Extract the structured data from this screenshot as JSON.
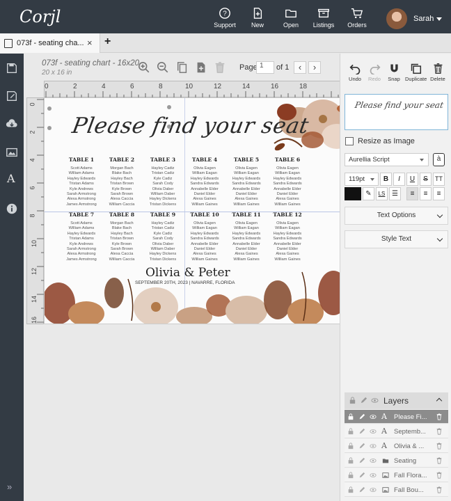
{
  "app": {
    "logo": "Corjl",
    "nav": [
      {
        "label": "Support",
        "icon": "help-icon"
      },
      {
        "label": "New",
        "icon": "new-file-icon"
      },
      {
        "label": "Open",
        "icon": "folder-icon"
      },
      {
        "label": "Listings",
        "icon": "listings-icon"
      },
      {
        "label": "Orders",
        "icon": "cart-icon"
      }
    ],
    "user": {
      "name": "Sarah"
    }
  },
  "tab": {
    "title": "073f - seating cha...",
    "close": "×",
    "add": "+"
  },
  "document": {
    "title": "073f - seating chart - 16x20",
    "size": "20 x 16 in",
    "page_label": "Page",
    "page_value": "1",
    "page_of": "of 1",
    "prev": "‹",
    "next": "›"
  },
  "ruler": {
    "h": [
      "0",
      "2",
      "4",
      "6",
      "8",
      "10",
      "12",
      "14",
      "16",
      "18"
    ],
    "v": [
      "0",
      "2",
      "4",
      "6",
      "8",
      "10",
      "12",
      "14",
      "16"
    ]
  },
  "canvas": {
    "caption": "Please find your seat",
    "couple": "Olivia & Peter",
    "date": "SEPTEMBER 20TH, 2023 | NAVARRE, FLORIDA",
    "tables": [
      {
        "title": "TABLE 1",
        "names": [
          "Scott Adams",
          "William Adams",
          "Hayley Edwards",
          "Tristan Adams",
          "Kyle Andrews",
          "Sarah Armstrong",
          "Alexa Armstrong",
          "James Armstrong"
        ]
      },
      {
        "title": "TABLE 2",
        "names": [
          "Morgan Bach",
          "Blake Bach",
          "Hayley Bach",
          "Tristan Brown",
          "Kyle Brown",
          "Sarah Brown",
          "Alexa Caccia",
          "William Caccia"
        ]
      },
      {
        "title": "TABLE 3",
        "names": [
          "Hayley Cadiz",
          "Tristan Cadiz",
          "Kyle Cadiz",
          "Sarah Cody",
          "Olivia Daber",
          "William Daber",
          "Hayley Dickens",
          "Tristan Dickens"
        ]
      },
      {
        "title": "TABLE 4",
        "names": [
          "Olivia Eagen",
          "William Eagan",
          "Hayley Edwards",
          "Sandra Edwards",
          "Annabelle Elder",
          "Daniel Elder",
          "Alexa Gaines",
          "William Gaines"
        ]
      },
      {
        "title": "TABLE 5",
        "names": [
          "Olivia Eagen",
          "William Eagan",
          "Hayley Edwards",
          "Sandra Edwards",
          "Annabelle Elder",
          "Daniel Elder",
          "Alexa Gaines",
          "William Gaines"
        ]
      },
      {
        "title": "TABLE 6",
        "names": [
          "Olivia Eagen",
          "William Eagan",
          "Hayley Edwards",
          "Sandra Edwards",
          "Annabelle Elder",
          "Daniel Elder",
          "Alexa Gaines",
          "William Gaines"
        ]
      },
      {
        "title": "TABLE 7",
        "names": [
          "Scott Adams",
          "William Adams",
          "Hayley Edwards",
          "Tristan Adams",
          "Kyle Andrews",
          "Sarah Armstrong",
          "Alexa Armstrong",
          "James Armstrong"
        ]
      },
      {
        "title": "TABLE 8",
        "names": [
          "Morgan Bach",
          "Blake Bach",
          "Hayley Bach",
          "Tristan Brown",
          "Kyle Brown",
          "Sarah Brown",
          "Alexa Caccia",
          "William Caccia"
        ]
      },
      {
        "title": "TABLE 9",
        "names": [
          "Hayley Cadiz",
          "Tristan Cadiz",
          "Kyle Cadiz",
          "Sarah Cody",
          "Olivia Daber",
          "William Daber",
          "Hayley Dickens",
          "Tristan Dickens"
        ]
      },
      {
        "title": "TABLE 10",
        "names": [
          "Olivia Eagen",
          "William Eagan",
          "Hayley Edwards",
          "Sandra Edwards",
          "Annabelle Elder",
          "Daniel Elder",
          "Alexa Gaines",
          "William Gaines"
        ]
      },
      {
        "title": "TABLE 11",
        "names": [
          "Olivia Eagen",
          "William Eagan",
          "Hayley Edwards",
          "Sandra Edwards",
          "Annabelle Elder",
          "Daniel Elder",
          "Alexa Gaines",
          "William Gaines"
        ]
      },
      {
        "title": "TABLE 12",
        "names": [
          "Olivia Eagen",
          "William Eagan",
          "Hayley Edwards",
          "Sandra Edwards",
          "Annabelle Elder",
          "Daniel Elder",
          "Alexa Gaines",
          "William Gaines"
        ]
      }
    ]
  },
  "panel": {
    "actions": [
      {
        "label": "Undo",
        "icon": "undo-icon",
        "enabled": true
      },
      {
        "label": "Redo",
        "icon": "redo-icon",
        "enabled": false
      },
      {
        "label": "Snap",
        "icon": "magnet-icon",
        "enabled": true
      },
      {
        "label": "Duplicate",
        "icon": "duplicate-icon",
        "enabled": true
      },
      {
        "label": "Delete",
        "icon": "trash-icon",
        "enabled": true
      }
    ],
    "preview_text": "Please find your seat",
    "resize_as_image": "Resize as Image",
    "font": "Aurellia Script",
    "font_button": "à",
    "size": "119pt",
    "format_buttons": [
      "B",
      "I",
      "U",
      "S",
      "TT"
    ],
    "text_options": "Text Options",
    "style_text": "Style Text",
    "text_color": "#111111"
  },
  "layers": {
    "title": "Layers",
    "items": [
      {
        "type": "A",
        "name": "Please Fi...",
        "selected": true
      },
      {
        "type": "A",
        "name": "Septemb...",
        "selected": false
      },
      {
        "type": "A",
        "name": "Olivia & ...",
        "selected": false
      },
      {
        "type": "folder",
        "name": "Seating",
        "selected": false
      },
      {
        "type": "image",
        "name": "Fall Flora...",
        "selected": false
      },
      {
        "type": "image",
        "name": "Fall Bou...",
        "selected": false
      }
    ]
  }
}
